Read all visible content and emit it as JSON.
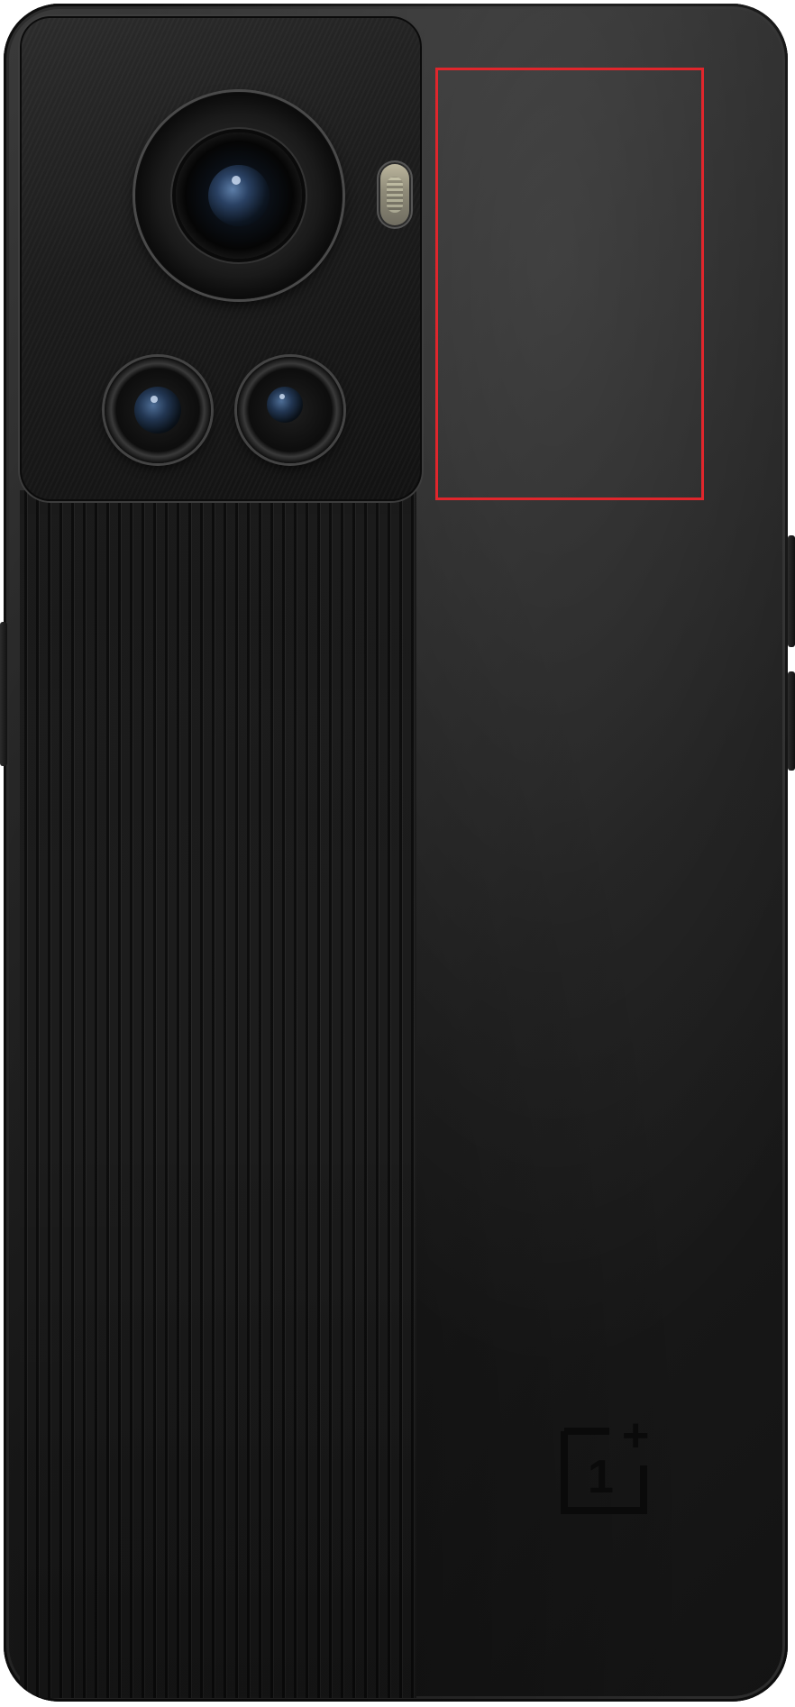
{
  "image": {
    "subject": "phone-back",
    "colors": {
      "body": "#1e1e1e",
      "highlight": "#e0262c",
      "logo": "#0a0a0a"
    }
  },
  "logo": {
    "digit": "1",
    "mark": "+"
  },
  "icons": {
    "main_lens": "camera-lens-icon",
    "secondary_lens": "camera-lens-icon",
    "flash": "flash-icon",
    "logo": "oneplus-logo-icon"
  }
}
